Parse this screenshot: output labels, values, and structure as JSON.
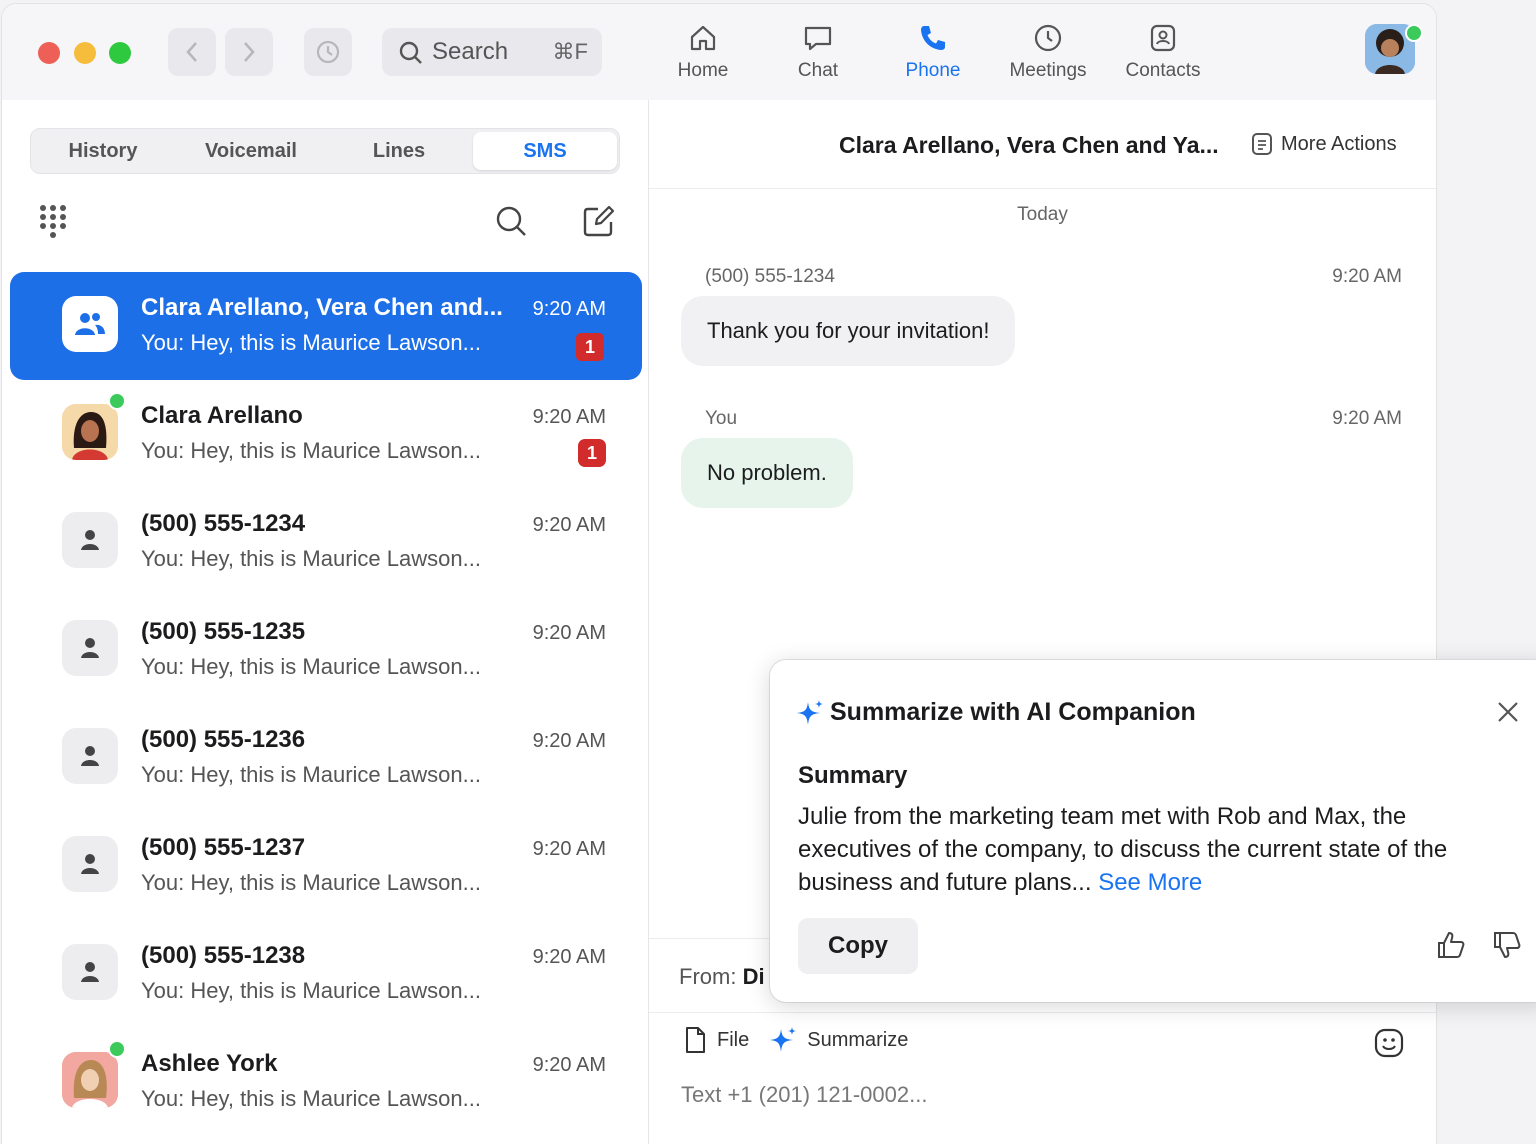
{
  "topbar": {
    "search_placeholder": "Search",
    "search_shortcut": "⌘F",
    "tabs": [
      {
        "label": "Home",
        "icon": "home-icon"
      },
      {
        "label": "Chat",
        "icon": "chat-icon"
      },
      {
        "label": "Phone",
        "icon": "phone-icon",
        "active": true
      },
      {
        "label": "Meetings",
        "icon": "clock-icon"
      },
      {
        "label": "Contacts",
        "icon": "contacts-icon"
      }
    ]
  },
  "left": {
    "segments": [
      {
        "label": "History"
      },
      {
        "label": "Voicemail"
      },
      {
        "label": "Lines"
      },
      {
        "label": "SMS",
        "active": true
      }
    ],
    "conversations": [
      {
        "name": "Clara Arellano, Vera Chen and...",
        "preview": "You: Hey, this is Maurice Lawson...",
        "time": "9:20 AM",
        "badge": "1",
        "selected": true,
        "avatar": "group-icon"
      },
      {
        "name": "Clara Arellano",
        "preview": "You: Hey, this is Maurice Lawson...",
        "time": "9:20 AM",
        "badge": "1",
        "avatar": "photo"
      },
      {
        "name": "(500) 555-1234",
        "preview": "You: Hey, this is Maurice Lawson...",
        "time": "9:20 AM",
        "avatar": "person-icon"
      },
      {
        "name": "(500) 555-1235",
        "preview": "You: Hey, this is Maurice Lawson...",
        "time": "9:20 AM",
        "avatar": "person-icon"
      },
      {
        "name": "(500) 555-1236",
        "preview": "You: Hey, this is Maurice Lawson...",
        "time": "9:20 AM",
        "avatar": "person-icon"
      },
      {
        "name": "(500) 555-1237",
        "preview": "You: Hey, this is Maurice Lawson...",
        "time": "9:20 AM",
        "avatar": "person-icon"
      },
      {
        "name": "(500) 555-1238",
        "preview": "You: Hey, this is Maurice Lawson...",
        "time": "9:20 AM",
        "avatar": "person-icon"
      },
      {
        "name": "Ashlee York",
        "preview": "You: Hey, this is Maurice Lawson...",
        "time": "9:20 AM",
        "avatar": "photo"
      }
    ]
  },
  "chat": {
    "title": "Clara Arellano, Vera Chen and Ya...",
    "more_actions": "More Actions",
    "date_divider": "Today",
    "messages": [
      {
        "sender": "(500) 555-1234",
        "time": "9:20 AM",
        "text": "Thank you for your invitation!"
      },
      {
        "sender": "You",
        "time": "9:20 AM",
        "text": "No problem."
      }
    ],
    "from_label": "From:",
    "from_value": "Di",
    "file_label": "File",
    "summarize_label": "Summarize",
    "input_placeholder": "Text +1 (201) 121-0002..."
  },
  "ai_popup": {
    "title": "Summarize with AI Companion",
    "summary_label": "Summary",
    "summary_text": "Julie from the marketing team met with Rob and Max, the executives of the company, to discuss the current state of the business and future plans...",
    "see_more": "See More",
    "copy_label": "Copy"
  },
  "colors": {
    "accent": "#1a73f0",
    "selected_row": "#1d6fe8",
    "badge": "#d12b2b",
    "outgoing_bubble": "#e6f4ec",
    "incoming_bubble": "#f1f1f4"
  }
}
